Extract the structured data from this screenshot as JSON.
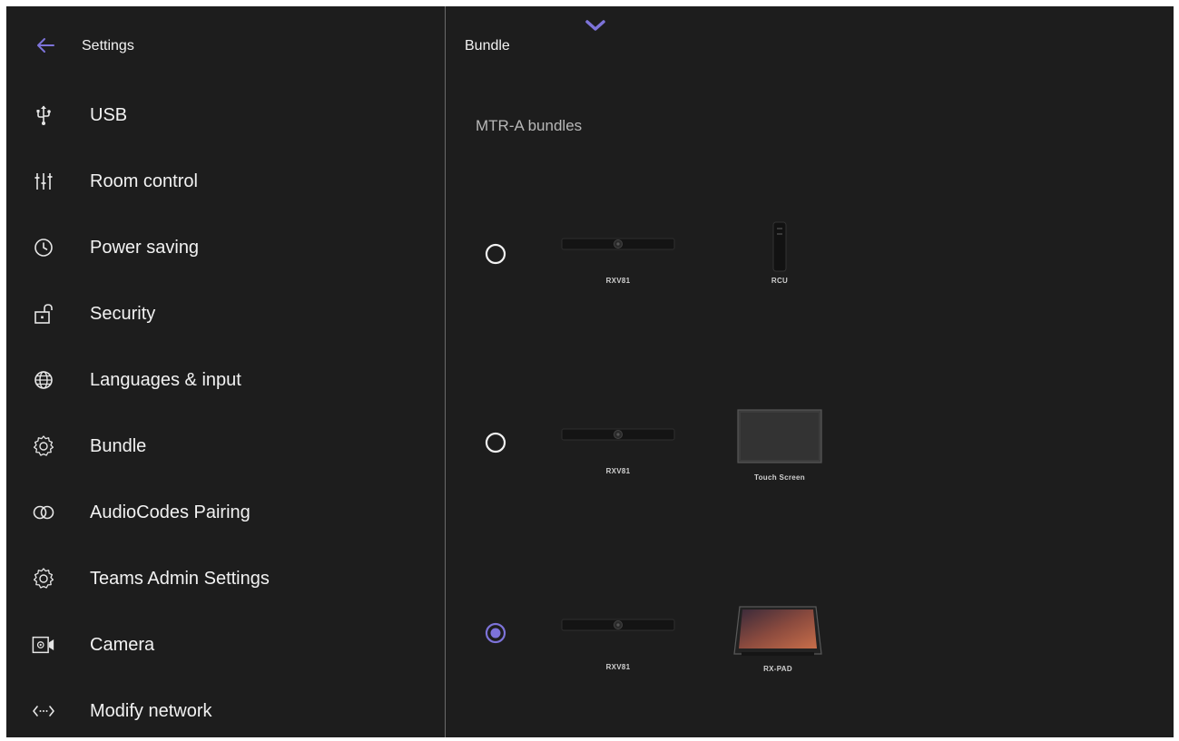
{
  "header": {
    "title": "Settings",
    "back_icon": "arrow-left-icon"
  },
  "accent_color": "#7d73d9",
  "sidebar": {
    "items": [
      {
        "label": "USB",
        "icon": "usb-icon"
      },
      {
        "label": "Room control",
        "icon": "sliders-icon"
      },
      {
        "label": "Power saving",
        "icon": "clock-icon"
      },
      {
        "label": "Security",
        "icon": "unlock-icon"
      },
      {
        "label": "Languages & input",
        "icon": "globe-icon"
      },
      {
        "label": "Bundle",
        "icon": "gear-icon"
      },
      {
        "label": "AudioCodes Pairing",
        "icon": "link-rings-icon"
      },
      {
        "label": "Teams Admin Settings",
        "icon": "gear-icon"
      },
      {
        "label": "Camera",
        "icon": "camera-icon"
      },
      {
        "label": "Modify network",
        "icon": "network-arrows-icon"
      }
    ]
  },
  "main": {
    "title": "Bundle",
    "collapse_icon": "chevron-down-icon",
    "section_title": "MTR-A bundles",
    "options": [
      {
        "selected": false,
        "devices": [
          "RXV81",
          "RCU"
        ]
      },
      {
        "selected": false,
        "devices": [
          "RXV81",
          "Touch Screen"
        ]
      },
      {
        "selected": true,
        "devices": [
          "RXV81",
          "RX-PAD"
        ]
      }
    ]
  }
}
